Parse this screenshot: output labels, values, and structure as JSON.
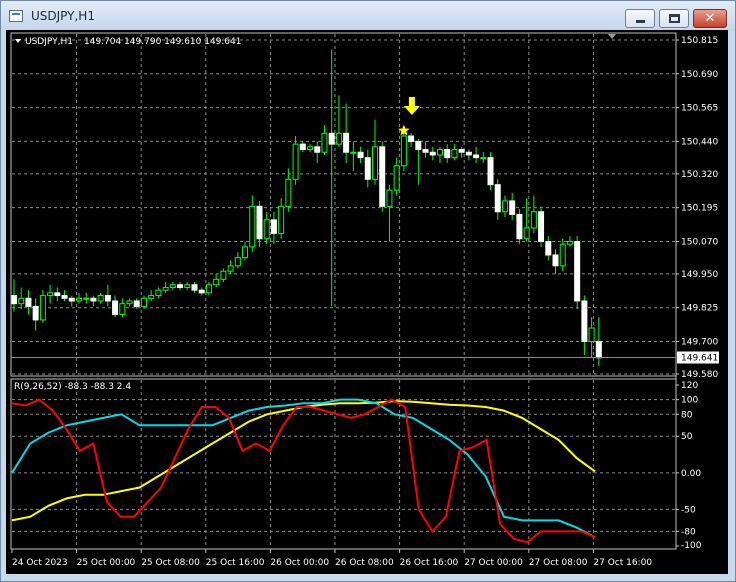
{
  "window": {
    "title": "USDJPY,H1"
  },
  "header": {
    "symbol": "USDJPY,H1",
    "ohlc": "149.704 149.790 149.610 149.641"
  },
  "oscillator": {
    "label": "R(9,26,52) -88.3 -88.3 2.4"
  },
  "colors": {
    "bull": "#00ff00",
    "bear": "#ffffff",
    "red": "#ff0000",
    "cyan": "#00d9e6",
    "yellow": "#ffff00",
    "grid": "#8a8a8a"
  },
  "chart_data": {
    "type": "candlestick",
    "price_axis": {
      "ticks": [
        "150.815",
        "150.690",
        "150.565",
        "150.440",
        "150.320",
        "150.195",
        "150.070",
        "149.950",
        "149.825",
        "149.700",
        "149.580"
      ],
      "min": 149.58,
      "max": 150.815
    },
    "current_price": "149.641",
    "time_axis": [
      "24 Oct 2023",
      "25 Oct 00:00",
      "25 Oct 08:00",
      "25 Oct 16:00",
      "26 Oct 00:00",
      "26 Oct 08:00",
      "26 Oct 16:00",
      "27 Oct 00:00",
      "27 Oct 08:00",
      "27 Oct 16:00"
    ],
    "candles": [
      [
        149.87,
        149.84,
        149.93,
        149.81
      ],
      [
        149.84,
        149.86,
        149.9,
        149.82
      ],
      [
        149.86,
        149.83,
        149.89,
        149.8
      ],
      [
        149.83,
        149.78,
        149.86,
        149.74
      ],
      [
        149.78,
        149.87,
        149.89,
        149.77
      ],
      [
        149.87,
        149.88,
        149.91,
        149.84
      ],
      [
        149.88,
        149.87,
        149.9,
        149.85
      ],
      [
        149.87,
        149.86,
        149.89,
        149.85
      ],
      [
        149.86,
        149.85,
        149.87,
        149.83
      ],
      [
        149.85,
        149.86,
        149.88,
        149.84
      ],
      [
        149.86,
        149.86,
        149.88,
        149.84
      ],
      [
        149.86,
        149.85,
        149.87,
        149.83
      ],
      [
        149.85,
        149.87,
        149.88,
        149.84
      ],
      [
        149.87,
        149.85,
        149.91,
        149.83
      ],
      [
        149.85,
        149.8,
        149.87,
        149.79
      ],
      [
        149.8,
        149.84,
        149.86,
        149.79
      ],
      [
        149.84,
        149.85,
        149.86,
        149.83
      ],
      [
        149.85,
        149.83,
        149.86,
        149.82
      ],
      [
        149.83,
        149.86,
        149.87,
        149.82
      ],
      [
        149.86,
        149.87,
        149.89,
        149.85
      ],
      [
        149.87,
        149.89,
        149.9,
        149.86
      ],
      [
        149.89,
        149.9,
        149.92,
        149.88
      ],
      [
        149.9,
        149.91,
        149.92,
        149.89
      ],
      [
        149.91,
        149.9,
        149.92,
        149.89
      ],
      [
        149.9,
        149.91,
        149.92,
        149.89
      ],
      [
        149.91,
        149.89,
        149.92,
        149.88
      ],
      [
        149.89,
        149.88,
        149.9,
        149.87
      ],
      [
        149.88,
        149.91,
        149.92,
        149.87
      ],
      [
        149.91,
        149.93,
        149.95,
        149.9
      ],
      [
        149.93,
        149.96,
        149.97,
        149.92
      ],
      [
        149.96,
        149.98,
        150.0,
        149.95
      ],
      [
        149.98,
        150.01,
        150.03,
        149.97
      ],
      [
        150.01,
        150.05,
        150.07,
        150.0
      ],
      [
        150.05,
        150.2,
        150.24,
        150.03
      ],
      [
        150.2,
        150.08,
        150.22,
        150.05
      ],
      [
        150.08,
        150.15,
        150.18,
        150.06
      ],
      [
        150.15,
        150.1,
        150.18,
        150.06
      ],
      [
        150.1,
        150.2,
        150.23,
        150.08
      ],
      [
        150.2,
        150.3,
        150.34,
        150.18
      ],
      [
        150.3,
        150.43,
        150.46,
        150.28
      ],
      [
        150.43,
        150.41,
        150.44,
        150.4
      ],
      [
        150.41,
        150.42,
        150.43,
        150.4
      ],
      [
        150.42,
        150.4,
        150.44,
        150.36
      ],
      [
        150.4,
        150.47,
        150.5,
        150.39
      ],
      [
        150.47,
        150.43,
        150.78,
        149.83
      ],
      [
        150.43,
        150.47,
        150.61,
        150.42
      ],
      [
        150.47,
        150.4,
        150.58,
        150.36
      ],
      [
        150.4,
        150.4,
        150.44,
        150.33
      ],
      [
        150.4,
        150.38,
        150.42,
        150.36
      ],
      [
        150.38,
        150.3,
        150.41,
        150.27
      ],
      [
        150.3,
        150.42,
        150.52,
        150.28
      ],
      [
        150.42,
        150.2,
        150.44,
        150.18
      ],
      [
        150.2,
        150.26,
        150.28,
        150.07
      ],
      [
        150.26,
        150.35,
        150.38,
        150.24
      ],
      [
        150.35,
        150.46,
        150.48,
        150.33
      ],
      [
        150.46,
        150.44,
        150.47,
        150.42
      ],
      [
        150.44,
        150.41,
        150.45,
        150.28
      ],
      [
        150.41,
        150.4,
        150.44,
        150.38
      ],
      [
        150.4,
        150.39,
        150.42,
        150.37
      ],
      [
        150.39,
        150.41,
        150.42,
        150.36
      ],
      [
        150.41,
        150.38,
        150.43,
        150.36
      ],
      [
        150.38,
        150.41,
        150.43,
        150.37
      ],
      [
        150.41,
        150.4,
        150.42,
        150.38
      ],
      [
        150.4,
        150.39,
        150.41,
        150.37
      ],
      [
        150.39,
        150.38,
        150.42,
        150.36
      ],
      [
        150.38,
        150.38,
        150.4,
        150.36
      ],
      [
        150.38,
        150.28,
        150.4,
        150.26
      ],
      [
        150.28,
        150.18,
        150.3,
        150.15
      ],
      [
        150.18,
        150.22,
        150.24,
        150.16
      ],
      [
        150.22,
        150.17,
        150.25,
        150.15
      ],
      [
        150.17,
        150.08,
        150.19,
        150.06
      ],
      [
        150.08,
        150.12,
        150.23,
        150.07
      ],
      [
        150.12,
        150.18,
        150.24,
        150.1
      ],
      [
        150.18,
        150.07,
        150.2,
        150.05
      ],
      [
        150.07,
        150.02,
        150.09,
        150.0
      ],
      [
        150.02,
        149.98,
        150.04,
        149.95
      ],
      [
        149.98,
        150.06,
        150.08,
        149.96
      ],
      [
        150.06,
        150.07,
        150.09,
        150.05
      ],
      [
        150.07,
        149.85,
        150.09,
        149.82
      ],
      [
        149.85,
        149.7,
        149.87,
        149.65
      ],
      [
        149.7,
        149.75,
        149.79,
        149.64
      ],
      [
        149.7,
        149.64,
        149.79,
        149.61
      ]
    ],
    "osc_axis": {
      "ticks": [
        "120",
        "100",
        "80",
        "50",
        "0.00",
        "-50",
        "-80",
        "-100"
      ],
      "min": -100,
      "max": 120
    },
    "red": [
      95,
      92,
      100,
      85,
      60,
      30,
      40,
      -40,
      -60,
      -60,
      -40,
      -20,
      20,
      60,
      90,
      90,
      75,
      30,
      40,
      30,
      65,
      90,
      90,
      85,
      80,
      75,
      80,
      90,
      100,
      90,
      -50,
      -80,
      -60,
      30,
      35,
      45,
      -70,
      -90,
      -95,
      -80,
      -80,
      -80,
      -80,
      -88
    ],
    "cyan": [
      0,
      40,
      55,
      65,
      70,
      75,
      80,
      65,
      65,
      65,
      65,
      65,
      75,
      85,
      90,
      92,
      95,
      95,
      100,
      100,
      95,
      80,
      75,
      60,
      45,
      25,
      -5,
      -60,
      -65,
      -65,
      -65,
      -75,
      -88
    ],
    "yellow": [
      -65,
      -60,
      -45,
      -35,
      -30,
      -30,
      -25,
      -20,
      -5,
      10,
      25,
      40,
      55,
      70,
      80,
      85,
      90,
      93,
      95,
      95,
      96,
      98,
      97,
      95,
      93,
      92,
      90,
      85,
      75,
      60,
      45,
      20,
      2
    ],
    "signal": {
      "star": 150.48,
      "arrow": 150.56,
      "candle_index": 54
    }
  }
}
